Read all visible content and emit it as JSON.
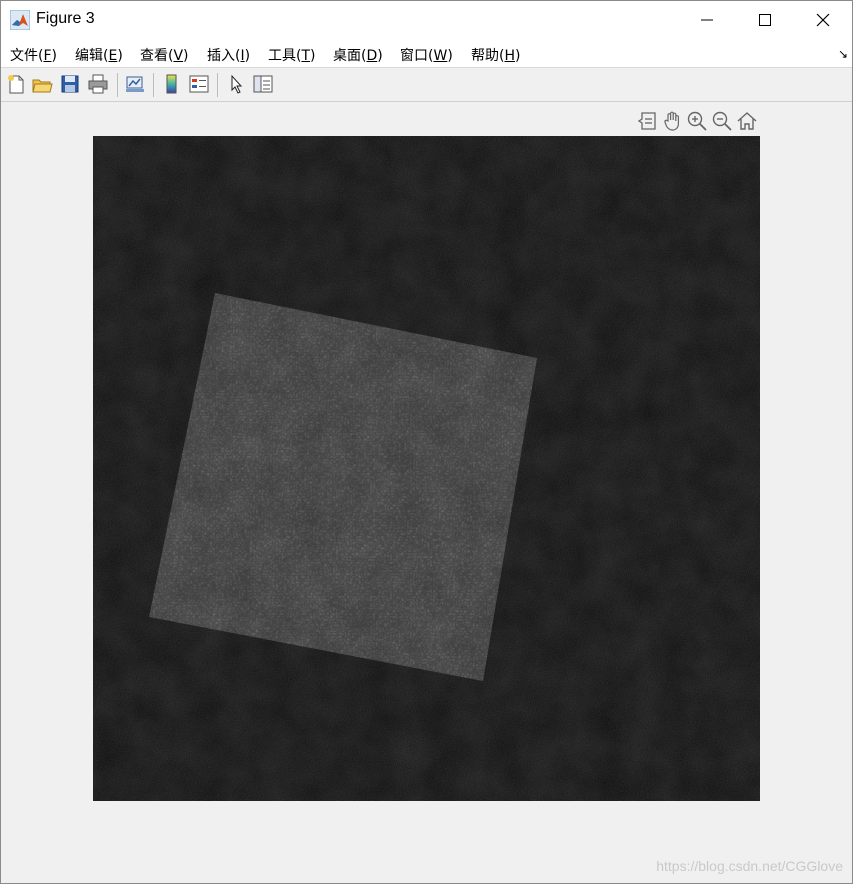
{
  "window": {
    "title": "Figure 3",
    "controls": [
      "minimize",
      "maximize",
      "close"
    ]
  },
  "menu": {
    "items": [
      {
        "label": "文件(",
        "mnemonic": "F",
        "tail": ")"
      },
      {
        "label": "编辑(",
        "mnemonic": "E",
        "tail": ")"
      },
      {
        "label": "查看(",
        "mnemonic": "V",
        "tail": ")"
      },
      {
        "label": "插入(",
        "mnemonic": "I",
        "tail": ")"
      },
      {
        "label": "工具(",
        "mnemonic": "T",
        "tail": ")"
      },
      {
        "label": "桌面(",
        "mnemonic": "D",
        "tail": ")"
      },
      {
        "label": "窗口(",
        "mnemonic": "W",
        "tail": ")"
      },
      {
        "label": "帮助(",
        "mnemonic": "H",
        "tail": ")"
      }
    ],
    "extra": "↘"
  },
  "toolbar": {
    "buttons": [
      "new-figure-icon",
      "open-file-icon",
      "save-icon",
      "print-icon",
      "link-plot-icon",
      "colorbar-icon",
      "legend-icon",
      "edit-plot-icon",
      "property-inspector-icon"
    ]
  },
  "axes_toolbar": {
    "buttons": [
      "data-tips-icon",
      "pan-icon",
      "zoom-in-icon",
      "zoom-out-icon",
      "restore-view-icon"
    ]
  },
  "image": {
    "content": "satellite-image-grayscale"
  },
  "watermark": "https://blog.csdn.net/CGGlove",
  "colors": {
    "titlebar": "#ffffff",
    "menubar": "#ffffff",
    "background": "#f0f0f0",
    "image_dark": "#1c1c1c",
    "image_overlay": "#4a4a4a"
  }
}
